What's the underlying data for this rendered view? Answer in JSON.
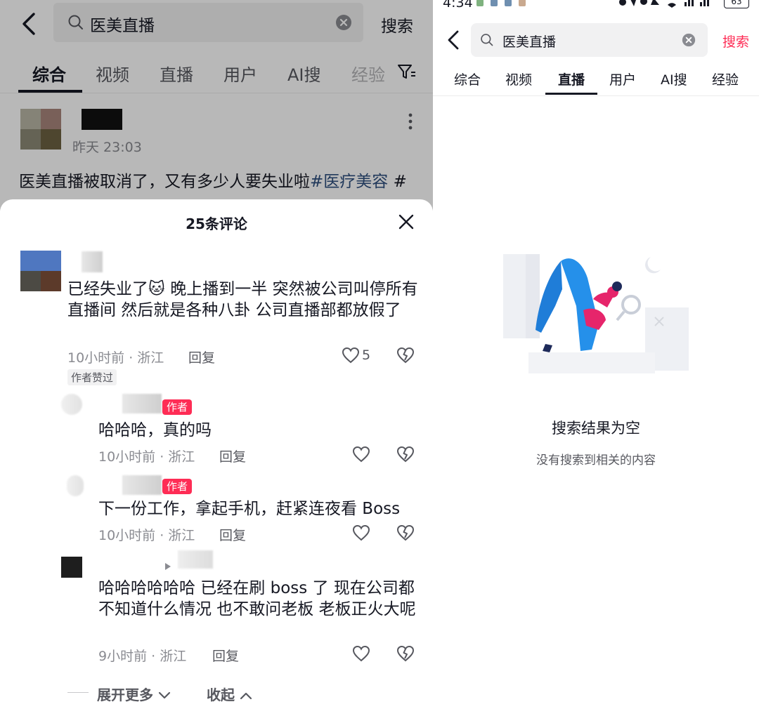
{
  "left": {
    "search": {
      "query": "医美直播",
      "button": "搜索"
    },
    "tabs": [
      {
        "label": "综合",
        "active": true
      },
      {
        "label": "视频",
        "active": false
      },
      {
        "label": "直播",
        "active": false
      },
      {
        "label": "用户",
        "active": false
      },
      {
        "label": "AI搜",
        "active": false
      },
      {
        "label": "经验",
        "active": false
      }
    ],
    "post": {
      "time": "昨天 23:03",
      "text_prefix": "医美直播被取消了，又有多少人要失业啦",
      "hashtag": "#医疗美容",
      "text_suffix": " #"
    },
    "comments_panel": {
      "title": "25条评论",
      "comments": [
        {
          "text": "已经失业了🐱      晚上播到一半    突然被公司叫停所有直播间     然后就是各种八卦    公司直播部都放假了",
          "meta": "10小时前 · 浙江",
          "reply": "回复",
          "likes": "5",
          "tag": "作者赞过"
        }
      ],
      "replies": [
        {
          "badge": "作者",
          "text": "哈哈哈，真的吗",
          "meta": "10小时前 · 浙江",
          "reply": "回复"
        },
        {
          "badge": "作者",
          "text": "下一份工作，拿起手机，赶紧连夜看 Boss",
          "meta": "10小时前 · 浙江",
          "reply": "回复"
        },
        {
          "badge": "",
          "text": "哈哈哈哈哈哈  已经在刷 boss 了   现在公司都不知道什么情况    也不敢问老板   老板正火大呢",
          "meta": "9小时前 · 浙江",
          "reply": "回复"
        }
      ],
      "expand": "展开更多",
      "collapse": "收起"
    }
  },
  "right": {
    "status": {
      "time": "4:34",
      "battery": "63"
    },
    "search": {
      "query": "医美直播",
      "button": "搜索"
    },
    "tabs": [
      {
        "label": "综合",
        "active": false
      },
      {
        "label": "视频",
        "active": false
      },
      {
        "label": "直播",
        "active": true
      },
      {
        "label": "用户",
        "active": false
      },
      {
        "label": "AI搜",
        "active": false
      },
      {
        "label": "经验",
        "active": false
      }
    ],
    "empty": {
      "title": "搜索结果为空",
      "subtitle": "没有搜索到相关的内容"
    }
  },
  "colors": {
    "accent": "#fe2c55",
    "link": "#2f4f7f"
  }
}
